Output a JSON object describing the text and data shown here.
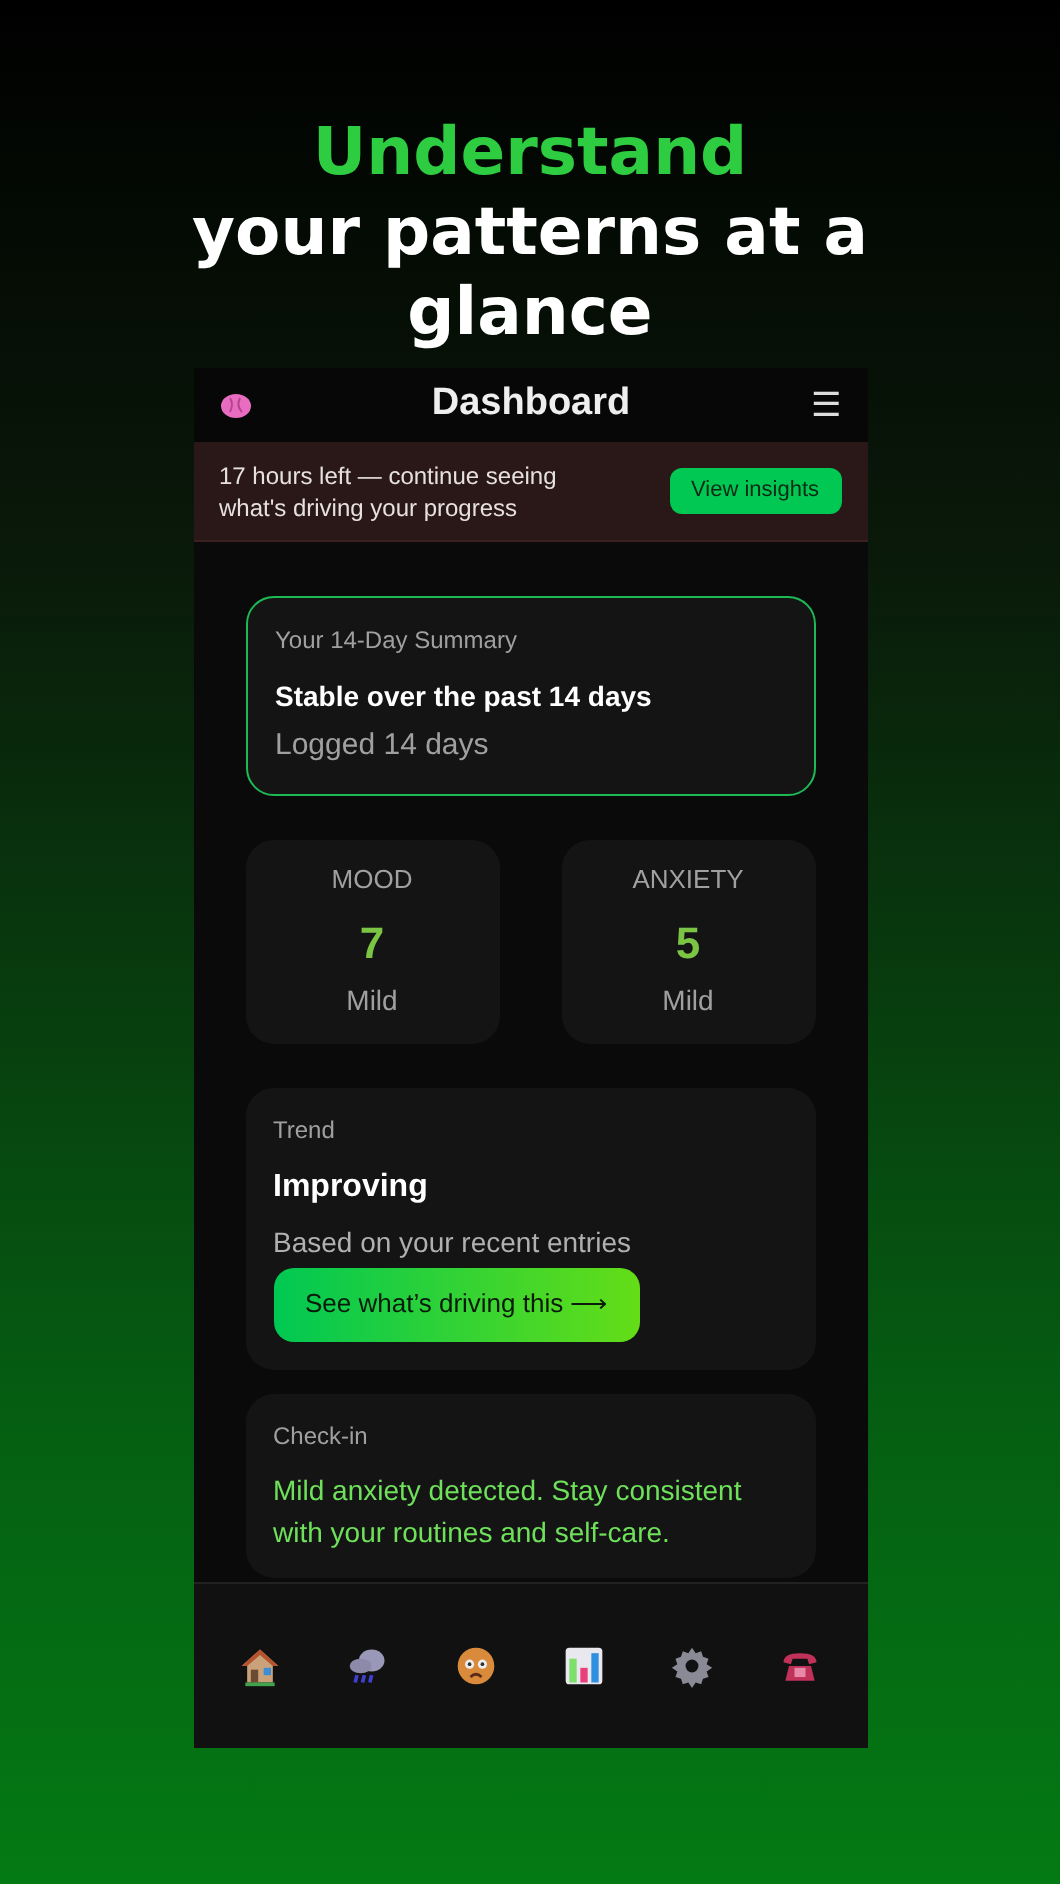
{
  "headline": {
    "accent": "Understand",
    "rest": "your patterns at a glance"
  },
  "header": {
    "title": "Dashboard",
    "menu_glyph": "☰"
  },
  "banner": {
    "text": "17 hours left — continue seeing what's driving your progress",
    "button": "View insights"
  },
  "summary": {
    "label": "Your 14-Day Summary",
    "title": "Stable over the past 14 days",
    "subtitle": "Logged 14 days"
  },
  "stats": [
    {
      "label": "MOOD",
      "value": "7",
      "caption": "Mild"
    },
    {
      "label": "ANXIETY",
      "value": "5",
      "caption": "Mild"
    }
  ],
  "trend": {
    "label": "Trend",
    "title": "Improving",
    "text": "Based on your recent entries",
    "button": "See what’s driving this ⟶"
  },
  "checkin": {
    "label": "Check-in",
    "text": "Mild anxiety detected. Stay consistent with your routines and self-care."
  },
  "nav": [
    {
      "kind": "home"
    },
    {
      "kind": "weather"
    },
    {
      "kind": "face"
    },
    {
      "kind": "chart"
    },
    {
      "kind": "settings"
    },
    {
      "kind": "phone"
    }
  ]
}
